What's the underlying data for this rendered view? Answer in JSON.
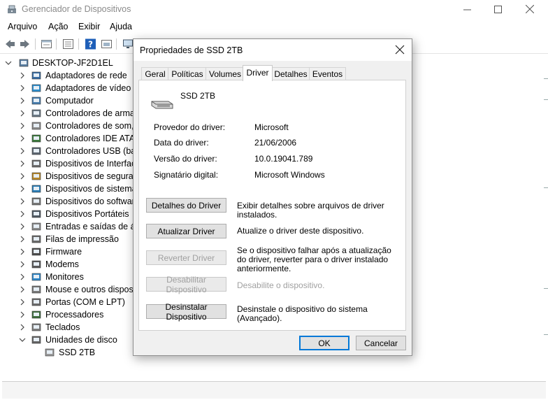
{
  "window": {
    "title": "Gerenciador de Dispositivos"
  },
  "menu": [
    "Arquivo",
    "Ação",
    "Exibir",
    "Ajuda"
  ],
  "tree": {
    "root": "DESKTOP-JF2D1EL",
    "categories": [
      {
        "label": "Adaptadores de rede",
        "icon": "network-adapter-icon"
      },
      {
        "label": "Adaptadores de vídeo",
        "icon": "display-adapter-icon"
      },
      {
        "label": "Computador",
        "icon": "computer-icon"
      },
      {
        "label": "Controladores de armaz",
        "icon": "storage-controller-icon"
      },
      {
        "label": "Controladores de som, v",
        "icon": "sound-icon"
      },
      {
        "label": "Controladores IDE ATA/A",
        "icon": "ide-controller-icon"
      },
      {
        "label": "Controladores USB (barr",
        "icon": "usb-icon"
      },
      {
        "label": "Dispositivos de Interface",
        "icon": "hid-icon"
      },
      {
        "label": "Dispositivos de seguranç",
        "icon": "security-device-icon"
      },
      {
        "label": "Dispositivos de sistema",
        "icon": "system-device-icon"
      },
      {
        "label": "Dispositivos do software",
        "icon": "software-device-icon"
      },
      {
        "label": "Dispositivos Portáteis",
        "icon": "portable-device-icon"
      },
      {
        "label": "Entradas e saídas de áud",
        "icon": "audio-io-icon"
      },
      {
        "label": "Filas de impressão",
        "icon": "print-queue-icon"
      },
      {
        "label": "Firmware",
        "icon": "firmware-icon"
      },
      {
        "label": "Modems",
        "icon": "modem-icon"
      },
      {
        "label": "Monitores",
        "icon": "monitor-icon"
      },
      {
        "label": "Mouse e outros dispositi",
        "icon": "mouse-icon"
      },
      {
        "label": "Portas (COM e LPT)",
        "icon": "port-icon"
      },
      {
        "label": "Processadores",
        "icon": "processor-icon"
      },
      {
        "label": "Teclados",
        "icon": "keyboard-icon"
      },
      {
        "label": "Unidades de disco",
        "icon": "disk-drive-icon"
      }
    ],
    "disk_child": "SSD 2TB"
  },
  "dialog": {
    "title": "Propriedades de SSD 2TB",
    "tabs": [
      "Geral",
      "Políticas",
      "Volumes",
      "Driver",
      "Detalhes",
      "Eventos"
    ],
    "active_tab": "Driver",
    "device_name": "SSD 2TB",
    "info": [
      {
        "label": "Provedor do driver:",
        "value": "Microsoft"
      },
      {
        "label": "Data do driver:",
        "value": "21/06/2006"
      },
      {
        "label": "Versão do driver:",
        "value": "10.0.19041.789"
      },
      {
        "label": "Signatário digital:",
        "value": "Microsoft Windows"
      }
    ],
    "actions": [
      {
        "label": "Detalhes do Driver",
        "desc": "Exibir detalhes sobre arquivos de driver instalados.",
        "enabled": true
      },
      {
        "label": "Atualizar Driver",
        "desc": "Atualize o driver deste dispositivo.",
        "enabled": true
      },
      {
        "label": "Reverter Driver",
        "desc": "Se o dispositivo falhar após a atualização do driver, reverter para o driver instalado anteriormente.",
        "enabled": false
      },
      {
        "label": "Desabilitar Dispositivo",
        "desc": "Desabilite o dispositivo.",
        "enabled": false
      },
      {
        "label": "Desinstalar Dispositivo",
        "desc": "Desinstale o dispositivo do sistema (Avançado).",
        "enabled": true
      }
    ],
    "ok_label": "OK",
    "cancel_label": "Cancelar"
  },
  "colors": {
    "accent": "#0078d7",
    "disabled_text": "#a0a0a0",
    "dialog_bg": "#f0f0f0"
  }
}
